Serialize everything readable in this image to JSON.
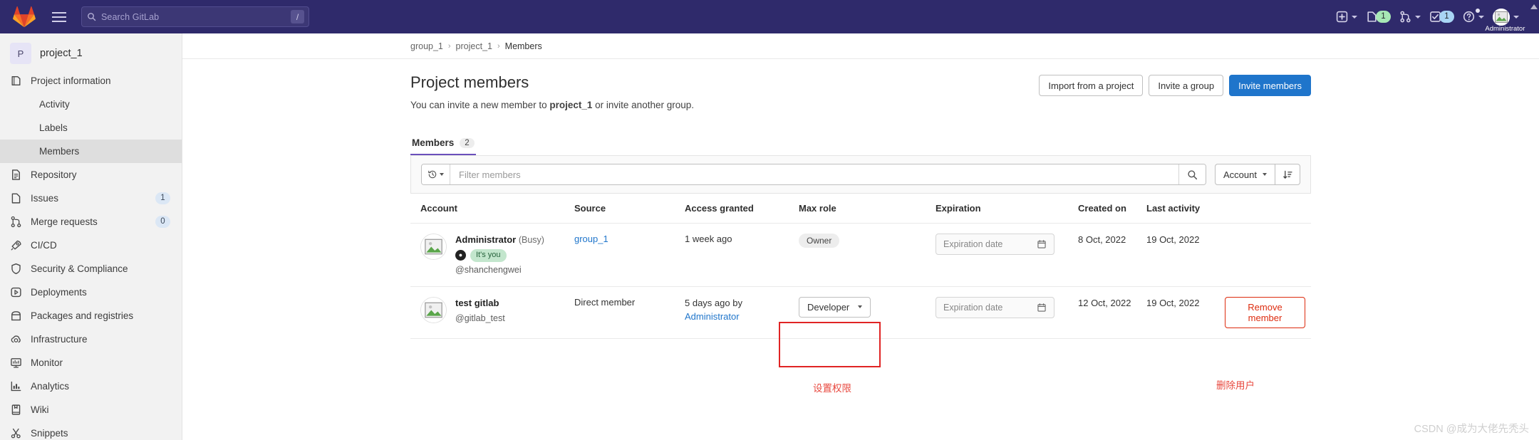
{
  "topnav": {
    "logo_icon": "gitlab-logo-icon",
    "hamburger_icon": "hamburger-menu-icon",
    "search": {
      "icon": "search-icon",
      "placeholder": "Search GitLab",
      "shortcut_key": "/"
    },
    "right_items": [
      {
        "icon": "plus-square-icon",
        "label": "",
        "chevron": true,
        "badge": null
      },
      {
        "icon": "issues-icon",
        "label": "",
        "chevron": false,
        "badge": "1",
        "badge_color": "#a7e8b5"
      },
      {
        "icon": "merge-request-icon",
        "label": "",
        "chevron": true,
        "badge": null
      },
      {
        "icon": "todos-checkbox-icon",
        "label": "",
        "chevron": false,
        "badge": "1",
        "badge_color": "#a9d5f5"
      },
      {
        "icon": "help-question-icon",
        "label": "",
        "chevron": true,
        "badge": null
      }
    ],
    "user": {
      "icon": "avatar-icon",
      "name": "Administrator",
      "chevron": true
    }
  },
  "sidebar": {
    "project": {
      "initial": "P",
      "name": "project_1"
    },
    "items": [
      {
        "label": "Project information",
        "icon": "project-info-icon",
        "sub": false,
        "active": false,
        "badge": null
      },
      {
        "label": "Activity",
        "icon": null,
        "sub": true,
        "active": false,
        "badge": null
      },
      {
        "label": "Labels",
        "icon": null,
        "sub": true,
        "active": false,
        "badge": null
      },
      {
        "label": "Members",
        "icon": null,
        "sub": true,
        "active": true,
        "badge": null
      },
      {
        "label": "Repository",
        "icon": "repository-icon",
        "sub": false,
        "active": false,
        "badge": null
      },
      {
        "label": "Issues",
        "icon": "issues-icon",
        "sub": false,
        "active": false,
        "badge": "1"
      },
      {
        "label": "Merge requests",
        "icon": "merge-request-icon",
        "sub": false,
        "active": false,
        "badge": "0"
      },
      {
        "label": "CI/CD",
        "icon": "rocket-icon",
        "sub": false,
        "active": false,
        "badge": null
      },
      {
        "label": "Security & Compliance",
        "icon": "shield-icon",
        "sub": false,
        "active": false,
        "badge": null
      },
      {
        "label": "Deployments",
        "icon": "deployments-icon",
        "sub": false,
        "active": false,
        "badge": null
      },
      {
        "label": "Packages and registries",
        "icon": "package-icon",
        "sub": false,
        "active": false,
        "badge": null
      },
      {
        "label": "Infrastructure",
        "icon": "cloud-gear-icon",
        "sub": false,
        "active": false,
        "badge": null
      },
      {
        "label": "Monitor",
        "icon": "monitor-icon",
        "sub": false,
        "active": false,
        "badge": null
      },
      {
        "label": "Analytics",
        "icon": "analytics-chart-icon",
        "sub": false,
        "active": false,
        "badge": null
      },
      {
        "label": "Wiki",
        "icon": "wiki-book-icon",
        "sub": false,
        "active": false,
        "badge": null
      },
      {
        "label": "Snippets",
        "icon": "snippets-scissors-icon",
        "sub": false,
        "active": false,
        "badge": null
      }
    ]
  },
  "breadcrumb": [
    {
      "label": "group_1",
      "link": true
    },
    {
      "label": "project_1",
      "link": true
    },
    {
      "label": "Members",
      "link": false
    }
  ],
  "page": {
    "title": "Project members",
    "subtitle_prefix": "You can invite a new member to ",
    "subtitle_bold": "project_1",
    "subtitle_suffix": " or invite another group.",
    "actions": {
      "import": "Import from a project",
      "invite_group": "Invite a group",
      "invite_members": "Invite members"
    }
  },
  "tabs": [
    {
      "label": "Members",
      "count": "2",
      "active": true
    }
  ],
  "filterbar": {
    "history_icon": "history-clock-icon",
    "filter_placeholder": "Filter members",
    "filter_value": "",
    "search_icon": "search-icon",
    "sort_by": "Account",
    "sort_dir_icon": "sort-descending-icon"
  },
  "table": {
    "headers": [
      "Account",
      "Source",
      "Access granted",
      "Max role",
      "Expiration",
      "Created on",
      "Last activity",
      ""
    ],
    "rows": [
      {
        "name": "Administrator",
        "status_note": "(Busy)",
        "status_emoji": "status-emoji-icon",
        "its_you": "It's you",
        "handle": "@shanchengwei",
        "source": "group_1",
        "source_is_link": true,
        "granted": "1 week ago",
        "granted_by": "",
        "granted_by_link": "",
        "role_type": "pill",
        "role": "Owner",
        "expiration_placeholder": "Expiration date",
        "created_on": "8 Oct, 2022",
        "last_activity": "19 Oct, 2022",
        "action": ""
      },
      {
        "name": "test gitlab",
        "status_note": "",
        "status_emoji": "",
        "its_you": "",
        "handle": "@gitlab_test",
        "source": "Direct member",
        "source_is_link": false,
        "granted": "5 days ago by",
        "granted_by": "",
        "granted_by_link": "Administrator",
        "role_type": "dropdown",
        "role": "Developer",
        "expiration_placeholder": "Expiration date",
        "created_on": "12 Oct, 2022",
        "last_activity": "19 Oct, 2022",
        "action": "Remove member"
      }
    ]
  },
  "annotations": {
    "set_permission": "设置权限",
    "delete_user": "删除用户",
    "highlight_color": "#e02424"
  },
  "watermark": "CSDN @成为大佬先秃头"
}
